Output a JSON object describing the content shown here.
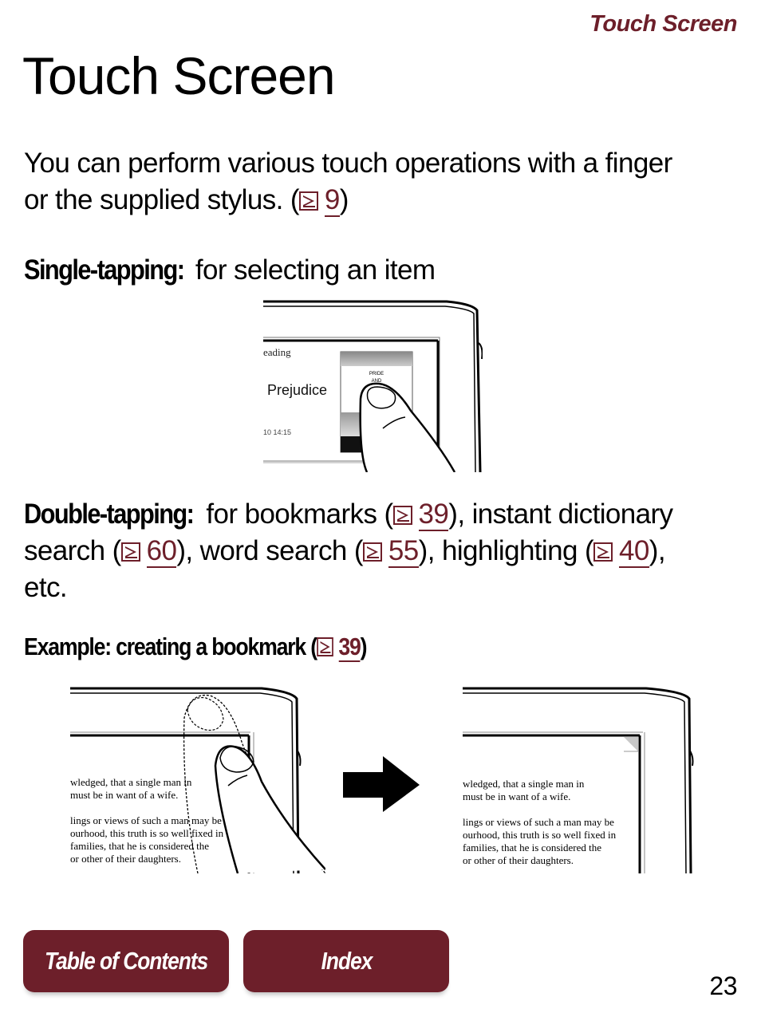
{
  "header": {
    "section_title": "Touch Screen"
  },
  "page_title": "Touch Screen",
  "intro": {
    "text": "You can perform various touch operations with a finger or the supplied stylus. (",
    "xref_page": "9",
    "close": ")"
  },
  "single_tapping": {
    "label": "Single-tapping:",
    "description": " for selecting an item",
    "illustration": {
      "screen_heading": "eading",
      "book_title": "Prejudice",
      "cover_line1": "PRIDE",
      "cover_line2": "AND",
      "timestamp": "10 14:15"
    }
  },
  "double_tapping": {
    "label": "Double-tapping:",
    "parts": [
      {
        "text": " for bookmarks (",
        "xref": "39",
        "after": "), instant"
      },
      {
        "text": " dictionary search (",
        "xref": "60",
        "after": "), word search ("
      },
      {
        "text": "",
        "xref": "55",
        "after": "),"
      },
      {
        "text": " highlighting (",
        "xref": "40",
        "after": "), etc."
      }
    ]
  },
  "example": {
    "text": "Example: creating a bookmark (",
    "xref_page": "39",
    "close": ")"
  },
  "reader_text": [
    "wledged, that a single man in",
    "must be in want of a wife.",
    "",
    "lings or views of such a man may be",
    "ourhood, this truth is so well fixed in",
    "families, that he is considered the",
    "or other of their daughters."
  ],
  "nav": {
    "toc_label": "Table of Contents",
    "index_label": "Index"
  },
  "page_number": "23",
  "colors": {
    "accent": "#6d1f2a"
  }
}
